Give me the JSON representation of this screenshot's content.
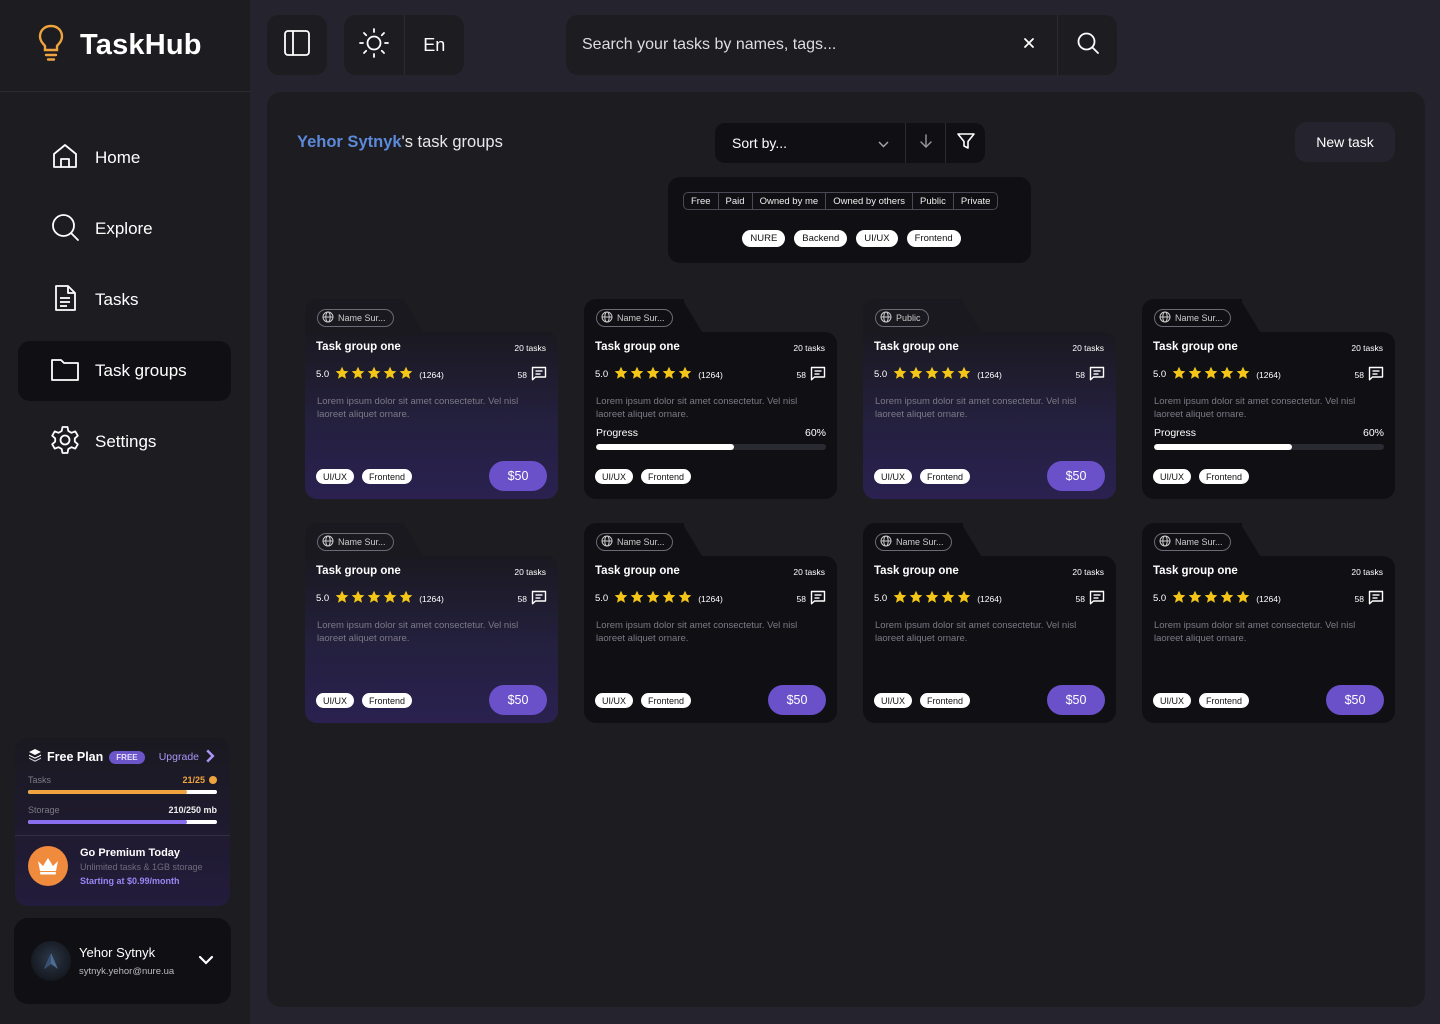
{
  "app": {
    "name": "TaskHub"
  },
  "nav": [
    {
      "label": "Home",
      "icon": "home-icon",
      "active": false
    },
    {
      "label": "Explore",
      "icon": "search-icon",
      "active": false
    },
    {
      "label": "Tasks",
      "icon": "document-icon",
      "active": false
    },
    {
      "label": "Task groups",
      "icon": "folder-icon",
      "active": true
    },
    {
      "label": "Settings",
      "icon": "gear-icon",
      "active": false
    }
  ],
  "plan": {
    "title": "Free Plan",
    "badge": "FREE",
    "upgrade": "Upgrade",
    "tasks_label": "Tasks",
    "tasks_value": "21/25",
    "tasks_fraction": 0.84,
    "storage_label": "Storage",
    "storage_value": "210/250 mb",
    "storage_fraction": 0.84,
    "premium_title": "Go Premium Today",
    "premium_sub": "Unlimited tasks & 1GB storage",
    "premium_price": "Starting at $0.99/month"
  },
  "user": {
    "name": "Yehor Sytnyk",
    "email": "sytnyk.yehor@nure.ua"
  },
  "topbar": {
    "language": "En",
    "search_placeholder": "Search your tasks by names, tags..."
  },
  "main": {
    "owner": "Yehor Sytnyk",
    "heading_suffix": "'s task groups",
    "sort_label": "Sort by...",
    "new_task": "New task",
    "filter_segments": [
      "Free",
      "Paid",
      "Owned by me",
      "Owned by others",
      "Public",
      "Private"
    ],
    "filter_tags": [
      "NURE",
      "Backend",
      "UI/UX",
      "Frontend"
    ]
  },
  "colors": {
    "accent": "#6a50c9",
    "owner_link": "#5c8ad9",
    "star": "#f5c518",
    "warning": "#f0a440"
  },
  "cards": [
    {
      "style": "purple",
      "owner": "Name Sur...",
      "title": "Task group one",
      "count": "20 tasks",
      "rating": "5.0",
      "reviews": "(1264)",
      "comments": "58",
      "desc": "Lorem ipsum dolor sit amet consectetur. Vel nisl laoreet aliquet ornare.",
      "progress": null,
      "tags": [
        "UI/UX",
        "Frontend"
      ],
      "price": "$50"
    },
    {
      "style": "dark",
      "owner": "Name Sur...",
      "title": "Task group one",
      "count": "20 tasks",
      "rating": "5.0",
      "reviews": "(1264)",
      "comments": "58",
      "desc": "Lorem ipsum dolor sit amet consectetur. Vel nisl laoreet aliquet ornare.",
      "progress": {
        "label": "Progress",
        "value": "60%",
        "fraction": 0.6
      },
      "tags": [
        "UI/UX",
        "Frontend"
      ],
      "price": null
    },
    {
      "style": "purple",
      "owner": "Public",
      "title": "Task group one",
      "count": "20 tasks",
      "rating": "5.0",
      "reviews": "(1264)",
      "comments": "58",
      "desc": "Lorem ipsum dolor sit amet consectetur. Vel nisl laoreet aliquet ornare.",
      "progress": null,
      "tags": [
        "UI/UX",
        "Frontend"
      ],
      "price": "$50"
    },
    {
      "style": "dark",
      "owner": "Name Sur...",
      "title": "Task group one",
      "count": "20 tasks",
      "rating": "5.0",
      "reviews": "(1264)",
      "comments": "58",
      "desc": "Lorem ipsum dolor sit amet consectetur. Vel nisl laoreet aliquet ornare.",
      "progress": {
        "label": "Progress",
        "value": "60%",
        "fraction": 0.6
      },
      "tags": [
        "UI/UX",
        "Frontend"
      ],
      "price": null
    },
    {
      "style": "purple",
      "owner": "Name Sur...",
      "title": "Task group one",
      "count": "20 tasks",
      "rating": "5.0",
      "reviews": "(1264)",
      "comments": "58",
      "desc": "Lorem ipsum dolor sit amet consectetur. Vel nisl laoreet aliquet ornare.",
      "progress": null,
      "tags": [
        "UI/UX",
        "Frontend"
      ],
      "price": "$50"
    },
    {
      "style": "dark",
      "owner": "Name Sur...",
      "title": "Task group one",
      "count": "20 tasks",
      "rating": "5.0",
      "reviews": "(1264)",
      "comments": "58",
      "desc": "Lorem ipsum dolor sit amet consectetur. Vel nisl laoreet aliquet ornare.",
      "progress": null,
      "tags": [
        "UI/UX",
        "Frontend"
      ],
      "price": "$50"
    },
    {
      "style": "dark",
      "owner": "Name Sur...",
      "title": "Task group one",
      "count": "20 tasks",
      "rating": "5.0",
      "reviews": "(1264)",
      "comments": "58",
      "desc": "Lorem ipsum dolor sit amet consectetur. Vel nisl laoreet aliquet ornare.",
      "progress": null,
      "tags": [
        "UI/UX",
        "Frontend"
      ],
      "price": "$50"
    },
    {
      "style": "dark",
      "owner": "Name Sur...",
      "title": "Task group one",
      "count": "20 tasks",
      "rating": "5.0",
      "reviews": "(1264)",
      "comments": "58",
      "desc": "Lorem ipsum dolor sit amet consectetur. Vel nisl laoreet aliquet ornare.",
      "progress": null,
      "tags": [
        "UI/UX",
        "Frontend"
      ],
      "price": "$50"
    }
  ]
}
